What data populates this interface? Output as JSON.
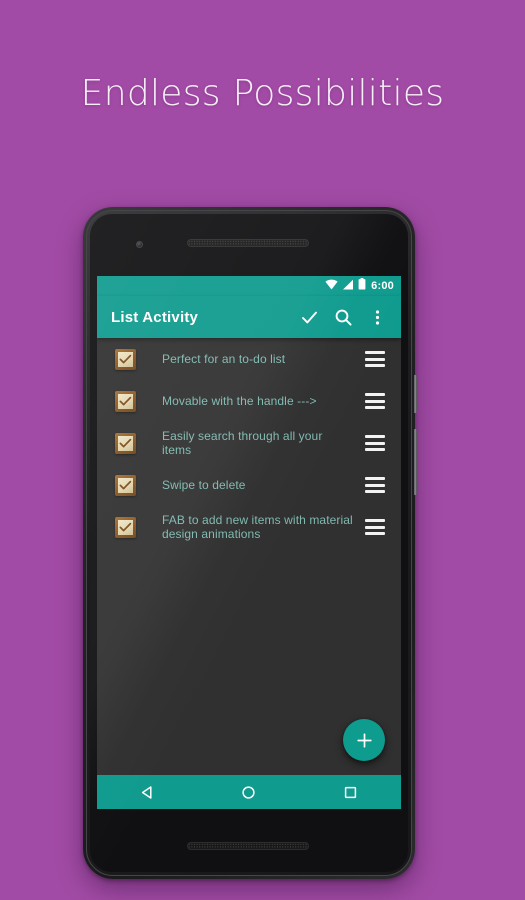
{
  "promo": {
    "headline": "Endless Possibilities"
  },
  "colors": {
    "background_purple": "#a24ba6",
    "accent_teal": "#0f9b8e",
    "screen_dark": "#303030",
    "list_text": "#7fb9b0",
    "checkbox_frame": "#8a5620",
    "checkbox_face": "#e2d5ad"
  },
  "device": {
    "name": "android-phone",
    "front_camera": "front-camera",
    "speaker_top": "earpiece-speaker-grille",
    "speaker_bottom": "bottom-speaker-grille",
    "power_button": "power-button",
    "volume_button": "volume-button"
  },
  "status_bar": {
    "clock": "6:00",
    "icons": [
      "wifi-icon",
      "signal-icon",
      "battery-icon"
    ]
  },
  "app_bar": {
    "title": "List Activity",
    "actions": [
      {
        "name": "check-icon",
        "label": "Check"
      },
      {
        "name": "search-icon",
        "label": "Search"
      },
      {
        "name": "overflow-menu-icon",
        "label": "More options"
      }
    ]
  },
  "list": {
    "items": [
      {
        "label": "Perfect for an to-do list",
        "checked": true
      },
      {
        "label": "Movable with the handle --->",
        "checked": true
      },
      {
        "label": "Easily search through all your items",
        "checked": true
      },
      {
        "label": "Swipe to delete",
        "checked": true
      },
      {
        "label": "FAB to add new items with material design animations",
        "checked": true
      }
    ]
  },
  "fab": {
    "name": "add-fab",
    "icon": "plus-icon",
    "label": "+"
  },
  "nav_bar": {
    "buttons": [
      {
        "name": "nav-back-button",
        "icon": "back-triangle-icon"
      },
      {
        "name": "nav-home-button",
        "icon": "home-circle-icon"
      },
      {
        "name": "nav-recents-button",
        "icon": "recents-square-icon"
      }
    ]
  }
}
